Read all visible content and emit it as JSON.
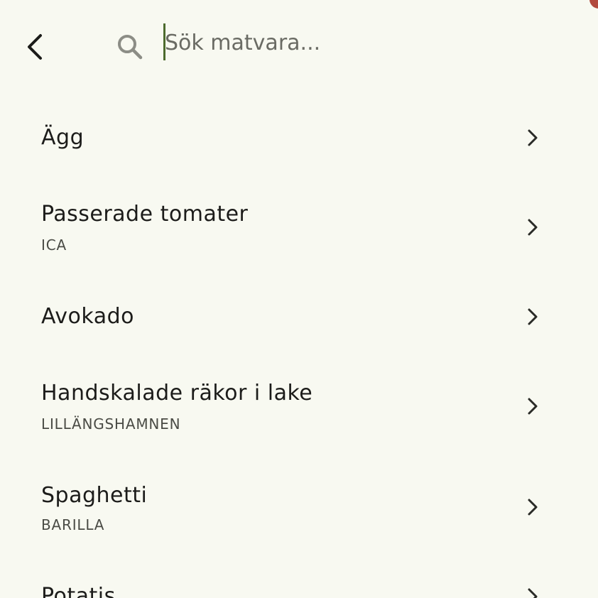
{
  "search": {
    "placeholder": "Sök matvara...",
    "value": ""
  },
  "icons": {
    "back": "chevron-left-icon",
    "search": "search-icon",
    "row": "chevron-right-icon"
  },
  "colors": {
    "background": "#f8f9f1",
    "caret": "#4d6b2e",
    "text": "#1c1c1a",
    "secondary_text": "#4a4b45",
    "search_icon": "#8c8d86"
  },
  "items": [
    {
      "name": "Ägg",
      "brand": ""
    },
    {
      "name": "Passerade tomater",
      "brand": "ICA"
    },
    {
      "name": "Avokado",
      "brand": ""
    },
    {
      "name": "Handskalade räkor i lake",
      "brand": "LILLÄNGSHAMNEN"
    },
    {
      "name": "Spaghetti",
      "brand": "BARILLA"
    },
    {
      "name": "Potatis",
      "brand": ""
    }
  ]
}
